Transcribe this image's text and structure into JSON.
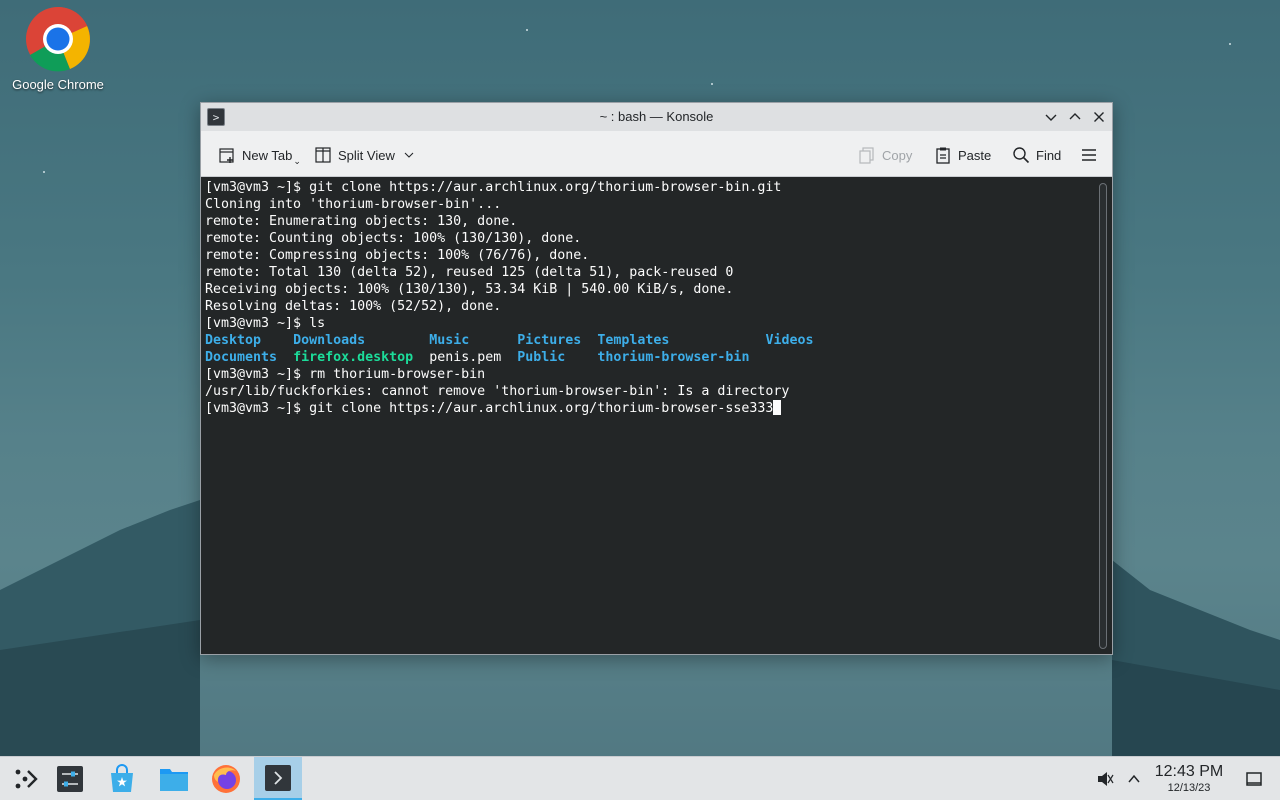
{
  "desktop": {
    "icons": [
      {
        "label": "Google Chrome",
        "icon": "chrome-icon"
      }
    ]
  },
  "window": {
    "title": "~ : bash — Konsole",
    "toolbar": {
      "new_tab": "New Tab",
      "split_view": "Split View",
      "copy": "Copy",
      "paste": "Paste",
      "find": "Find"
    }
  },
  "terminal": {
    "lines": [
      "[vm3@vm3 ~]$ git clone https://aur.archlinux.org/thorium-browser-bin.git",
      "Cloning into 'thorium-browser-bin'...",
      "remote: Enumerating objects: 130, done.",
      "remote: Counting objects: 100% (130/130), done.",
      "remote: Compressing objects: 100% (76/76), done.",
      "remote: Total 130 (delta 52), reused 125 (delta 51), pack-reused 0",
      "Receiving objects: 100% (130/130), 53.34 KiB | 540.00 KiB/s, done.",
      "Resolving deltas: 100% (52/52), done.",
      "[vm3@vm3 ~]$ ls"
    ],
    "ls_row1": [
      "Desktop",
      "Downloads",
      "Music",
      "Pictures",
      "Templates",
      "Videos"
    ],
    "ls_row2": [
      "Documents",
      "firefox.desktop",
      "penis.pem",
      "Public",
      "thorium-browser-bin"
    ],
    "after": [
      "[vm3@vm3 ~]$ rm thorium-browser-bin",
      "/usr/lib/fuckforkies: cannot remove 'thorium-browser-bin': Is a directory"
    ],
    "current_input": "[vm3@vm3 ~]$ git clone https://aur.archlinux.org/thorium-browser-sse333"
  },
  "taskbar": {
    "apps": [
      "app-launcher-icon",
      "system-settings-icon",
      "discover-icon",
      "file-manager-icon",
      "firefox-icon",
      "konsole-icon"
    ],
    "active_app": "konsole-icon",
    "clock_time": "12:43 PM",
    "clock_date": "12/13/23"
  },
  "colors": {
    "terminal_bg": "#232627",
    "directory": "#3daee9",
    "executable": "#1cdc9a",
    "accent": "#3daee9"
  }
}
